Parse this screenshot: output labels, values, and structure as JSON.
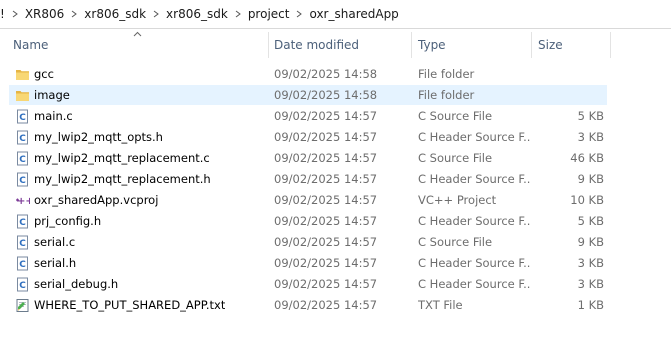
{
  "breadcrumb": {
    "lead": "!",
    "items": [
      "XR806",
      "xr806_sdk",
      "xr806_sdk",
      "project",
      "oxr_sharedApp"
    ]
  },
  "columns": {
    "name": "Name",
    "date": "Date modified",
    "type": "Type",
    "size": "Size"
  },
  "files": [
    {
      "name": "gcc",
      "date": "09/02/2025 14:58",
      "type": "File folder",
      "size": "",
      "icon": "folder-icon"
    },
    {
      "name": "image",
      "date": "09/02/2025 14:58",
      "type": "File folder",
      "size": "",
      "icon": "folder-icon"
    },
    {
      "name": "main.c",
      "date": "09/02/2025 14:57",
      "type": "C Source File",
      "size": "5 KB",
      "icon": "c-file-icon"
    },
    {
      "name": "my_lwip2_mqtt_opts.h",
      "date": "09/02/2025 14:57",
      "type": "C Header Source F...",
      "size": "3 KB",
      "icon": "c-file-icon"
    },
    {
      "name": "my_lwip2_mqtt_replacement.c",
      "date": "09/02/2025 14:57",
      "type": "C Source File",
      "size": "46 KB",
      "icon": "c-file-icon"
    },
    {
      "name": "my_lwip2_mqtt_replacement.h",
      "date": "09/02/2025 14:57",
      "type": "C Header Source F...",
      "size": "9 KB",
      "icon": "c-file-icon"
    },
    {
      "name": "oxr_sharedApp.vcproj",
      "date": "09/02/2025 14:57",
      "type": "VC++ Project",
      "size": "10 KB",
      "icon": "vcproj-icon"
    },
    {
      "name": "prj_config.h",
      "date": "09/02/2025 14:57",
      "type": "C Header Source F...",
      "size": "5 KB",
      "icon": "c-file-icon"
    },
    {
      "name": "serial.c",
      "date": "09/02/2025 14:57",
      "type": "C Source File",
      "size": "9 KB",
      "icon": "c-file-icon"
    },
    {
      "name": "serial.h",
      "date": "09/02/2025 14:57",
      "type": "C Header Source F...",
      "size": "3 KB",
      "icon": "c-file-icon"
    },
    {
      "name": "serial_debug.h",
      "date": "09/02/2025 14:57",
      "type": "C Header Source F...",
      "size": "3 KB",
      "icon": "c-file-icon"
    },
    {
      "name": "WHERE_TO_PUT_SHARED_APP.txt",
      "date": "09/02/2025 14:57",
      "type": "TXT File",
      "size": "1 KB",
      "icon": "text-file-icon"
    }
  ],
  "selected_index": 1,
  "colors": {
    "selection": "#e5f3ff",
    "header_text": "#4c607a",
    "folder": "#f8d775"
  }
}
